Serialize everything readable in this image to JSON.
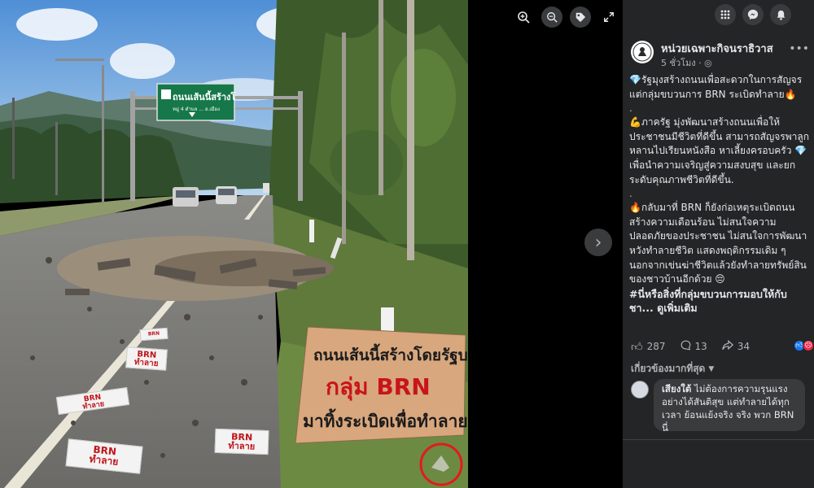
{
  "photo": {
    "road_sign": {
      "line1": "ถนนเส้นนี้สร้างโดยรัฐบาล",
      "line2": "กลุ่ม BRN",
      "line3": "มาทิ้งระเบิดเพื่อทำลาย"
    },
    "overhead_sign": {
      "line1": "ถนนเส้นนี้สร้างโ",
      "line2": "หมู่ 4 ตำบล ... อ.เมือง"
    },
    "flyers": [
      {
        "line1": "BRN",
        "line2": "ทำลาย"
      },
      {
        "line1": "BRN",
        "line2": "ทำลาย"
      },
      {
        "line1": "BRN",
        "line2": "ทำลาย"
      },
      {
        "line1": "BRN",
        "line2": "ทำลาย"
      },
      {
        "line1": "BRN",
        "line2": "ทำลาย"
      }
    ]
  },
  "viewer_tools": {
    "zoom_in_icon": "zoom-in-icon",
    "zoom_out_icon": "zoom-out-icon",
    "tag_icon": "tag-icon",
    "fullscreen_icon": "fullscreen-icon",
    "next_icon": "chevron-right-icon"
  },
  "topbar": {
    "menu_icon": "grid-menu-icon",
    "messenger_icon": "messenger-icon",
    "notifications_icon": "bell-icon"
  },
  "post": {
    "page_name": "หน่วยเฉพาะกิจนราธิวาส",
    "time": "5 ชั่วโมง · ",
    "audience_icon": "globe-icon",
    "more_icon": "more-icon",
    "paragraphs": {
      "p1": "💎รัฐมุงสร้างถนนเพื่อสะดวกในการสัญจร แต่กลุ่มขบวนการ BRN ระเบิดทำลาย🔥",
      "dot1": ".",
      "p2": "💪ภาครัฐ มุ่งพัฒนาสร้างถนนเพื่อให้ประชาชนมีชีวิตที่ดีขึ้น สามารถสัญจรพาลูกหลานไปเรียนหนังสือ หาเลี้ยงครอบครัว 💎 เพื่อนำความเจริญสู่ความสงบสุข และยกระดับคุณภาพชีวิตที่ดีขึ้น.",
      "dot2": ".",
      "p3": "🔥กลับมาที่ BRN ก็ยังก่อเหตุระเบิดถนนสร้างความเดือนร้อน ไม่สนใจความปลอดภัยของประชาชน ไม่สนใจการพัฒนา หวังทำลายชีวิต แสดงพฤติกรรมเดิม ๆ นอกจากเข่นฆ่าชีวิตแล้วยังทำลายทรัพย์สินของชาวบ้านอีกด้วย 😔",
      "hashtag": "#นี่หรือสิ่งที่กลุ่มขบวนการมอบให้กับชา...",
      "see_more": "ดูเพิ่มเติม"
    },
    "stats": {
      "likes": "287",
      "comments": "13",
      "shares": "34"
    },
    "sort_label": "เกี่ยวข้องมากที่สุด",
    "comment": {
      "author": "เสียงใต้",
      "text": " ไม่ต้องการความรุนแรง อย่างได้สันติสุข แต่ทำลายได้ทุกเวลา ย้อนแย้งจริง จริง พวก BRN นี่"
    }
  }
}
